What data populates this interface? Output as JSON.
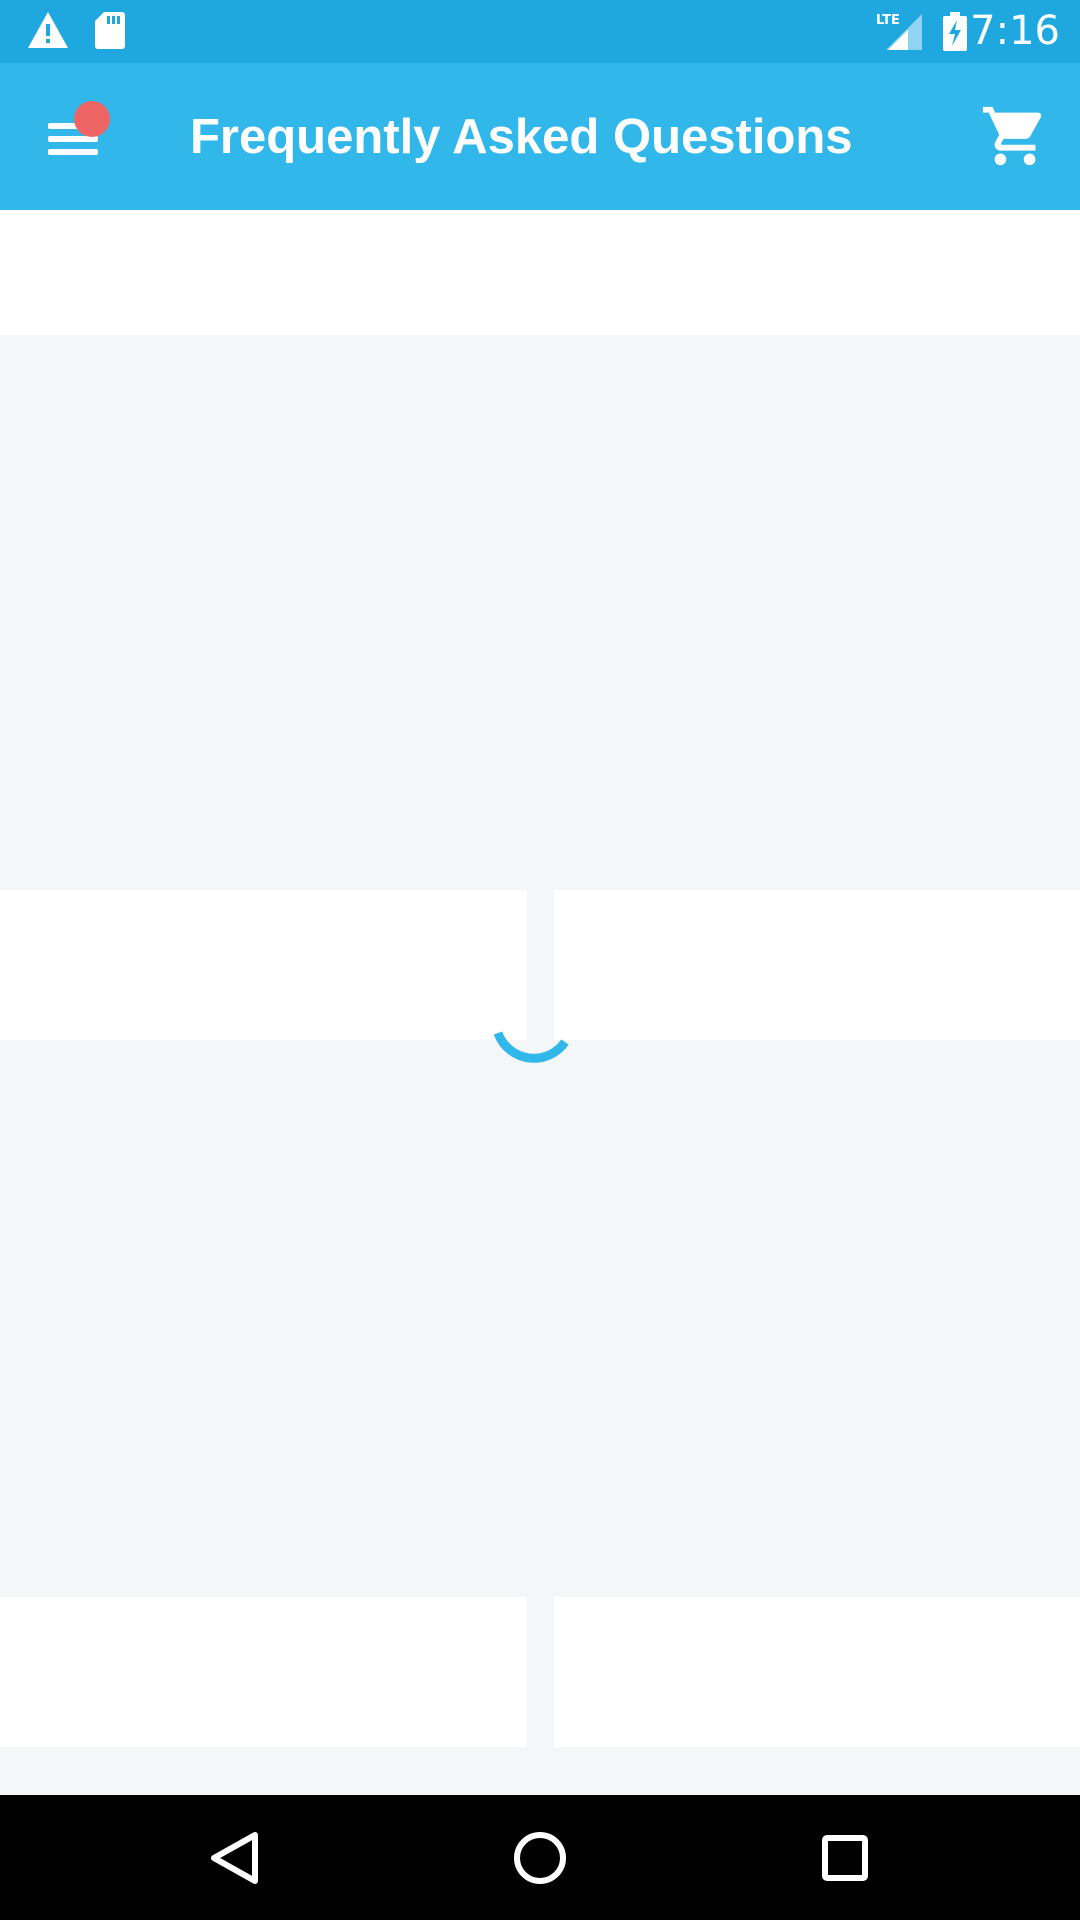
{
  "status_bar": {
    "time": "7:16",
    "network": "LTE",
    "icons": [
      "warning-icon",
      "sd-card-icon",
      "signal-icon",
      "battery-charging-icon"
    ]
  },
  "app_bar": {
    "title": "Frequently Asked Questions",
    "menu_icon": "menu-icon",
    "cart_icon": "cart-icon",
    "notification_badge_color": "#ef6565"
  },
  "content": {
    "state": "loading",
    "loader_color": "#31b7ea"
  },
  "nav_bar": {
    "buttons": [
      "back-icon",
      "home-icon",
      "recents-icon"
    ]
  },
  "colors": {
    "status_bar": "#1fa8e0",
    "app_bar": "#31b7ea",
    "background": "#f4f6f8"
  }
}
